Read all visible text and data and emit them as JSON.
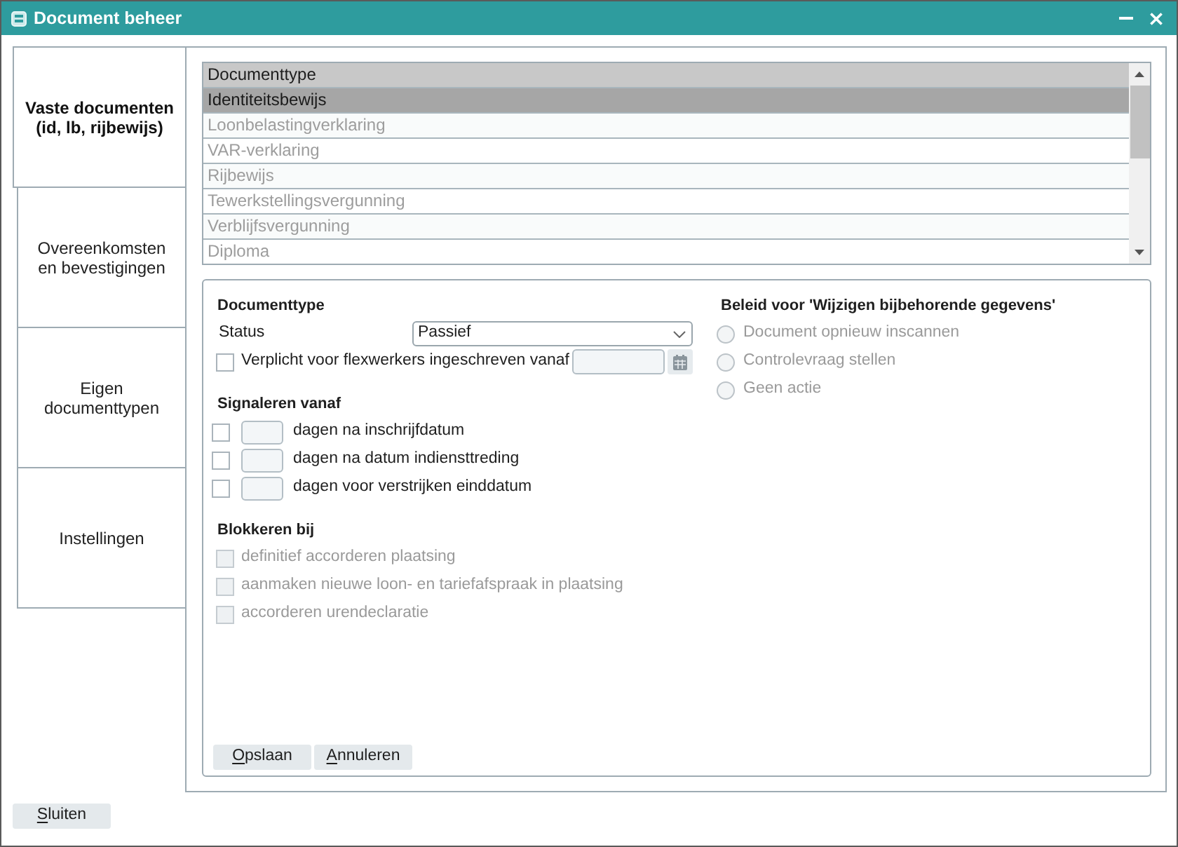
{
  "window": {
    "title": "Document beheer"
  },
  "tabs": [
    {
      "label": "Vaste documenten (id, lb, rijbewijs)",
      "selected": true
    },
    {
      "label": "Overeenkomsten en bevestigingen",
      "selected": false
    },
    {
      "label": "Eigen documenttypen",
      "selected": false
    },
    {
      "label": "Instellingen",
      "selected": false
    }
  ],
  "document_list": {
    "columns": [
      "Documenttype"
    ],
    "rows": [
      {
        "label": "Identiteitsbewijs",
        "selected": true
      },
      {
        "label": "Loonbelastingverklaring",
        "selected": false
      },
      {
        "label": "VAR-verklaring",
        "selected": false
      },
      {
        "label": "Rijbewijs",
        "selected": false
      },
      {
        "label": "Tewerkstellingsvergunning",
        "selected": false
      },
      {
        "label": "Verblijfsvergunning",
        "selected": false
      },
      {
        "label": "Diploma",
        "selected": false
      }
    ]
  },
  "form": {
    "title": "Documenttype",
    "status": {
      "label": "Status",
      "value": "Passief"
    },
    "mandatory": {
      "label": "Verplicht voor flexwerkers ingeschreven vanaf",
      "checked": false
    },
    "signal": {
      "title": "Signaleren vanaf",
      "rows": [
        {
          "label": "dagen na inschrijfdatum",
          "checked": false
        },
        {
          "label": "dagen na datum indiensttreding",
          "checked": false
        },
        {
          "label": "dagen voor verstrijken einddatum",
          "checked": false
        }
      ]
    },
    "block": {
      "title": "Blokkeren bij",
      "rows": [
        {
          "label": "definitief accorderen plaatsing",
          "checked": false,
          "disabled": true
        },
        {
          "label": "aanmaken nieuwe loon- en tariefafspraak in plaatsing",
          "checked": false,
          "disabled": true
        },
        {
          "label": "accorderen urendeclaratie",
          "checked": false,
          "disabled": true
        }
      ]
    },
    "policy": {
      "title": "Beleid voor 'Wijzigen bijbehorende gegevens'",
      "options": [
        {
          "label": "Document opnieuw inscannen",
          "selected": false,
          "disabled": true
        },
        {
          "label": "Controlevraag stellen",
          "selected": false,
          "disabled": true
        },
        {
          "label": "Geen actie",
          "selected": false,
          "disabled": true
        }
      ]
    },
    "buttons": [
      {
        "label": "Opslaan",
        "access_key_underlined": true
      },
      {
        "label": "Annuleren",
        "access_key_underlined": true
      }
    ]
  },
  "footer": {
    "buttons": [
      {
        "label": "Sluiten",
        "access_key_underlined": true
      }
    ]
  }
}
